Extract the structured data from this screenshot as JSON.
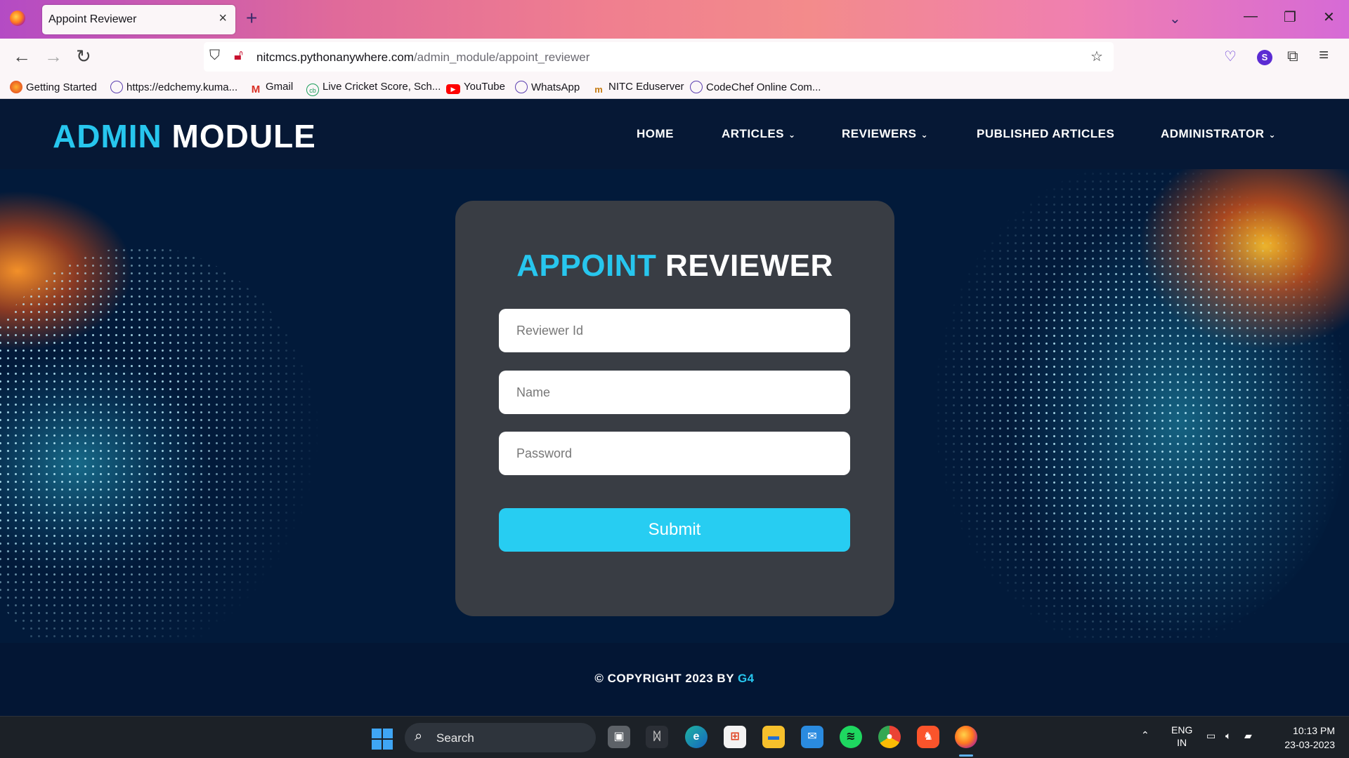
{
  "browser": {
    "tab_title": "Appoint Reviewer",
    "close_glyph": "×",
    "new_tab_glyph": "+",
    "tabs_list_glyph": "⌄",
    "url_domain": "nitcmcs.pythonanywhere.com",
    "url_path": "/admin_module/appoint_reviewer",
    "profile_initial": "S",
    "bookmarks": [
      {
        "label": "Getting Started",
        "icon": "firefox-icon"
      },
      {
        "label": "https://edchemy.kuma...",
        "icon": "globe-icon"
      },
      {
        "label": "Gmail",
        "icon": "gmail-icon"
      },
      {
        "label": "Live Cricket Score, Sch...",
        "icon": "cricbuzz-icon"
      },
      {
        "label": "YouTube",
        "icon": "youtube-icon"
      },
      {
        "label": "WhatsApp",
        "icon": "globe-icon"
      },
      {
        "label": "NITC Eduserver",
        "icon": "nitc-icon"
      },
      {
        "label": "CodeChef Online Com...",
        "icon": "globe-icon"
      }
    ]
  },
  "site": {
    "logo_accent": "ADMIN",
    "logo_rest": " MODULE",
    "nav": [
      {
        "label": "HOME",
        "dropdown": false
      },
      {
        "label": "ARTICLES",
        "dropdown": true
      },
      {
        "label": "REVIEWERS",
        "dropdown": true
      },
      {
        "label": "PUBLISHED ARTICLES",
        "dropdown": false
      },
      {
        "label": "ADMINISTRATOR",
        "dropdown": true
      }
    ],
    "chevron_glyph": "⌄"
  },
  "form": {
    "title_accent": "APPOINT",
    "title_rest": " REVIEWER",
    "reviewer_id_placeholder": "Reviewer Id",
    "name_placeholder": "Name",
    "password_placeholder": "Password",
    "submit_label": "Submit"
  },
  "footer": {
    "copyright_prefix": "© COPYRIGHT 2023 BY ",
    "copyright_accent": "G4"
  },
  "taskbar": {
    "search_label": "Search",
    "lang_top": "ENG",
    "lang_bottom": "IN",
    "time": "10:13 PM",
    "date": "23-03-2023"
  },
  "colors": {
    "accent": "#27c6ee",
    "page_bg": "#031634",
    "card_bg": "#393d44",
    "submit_bg": "#27cdf2"
  }
}
